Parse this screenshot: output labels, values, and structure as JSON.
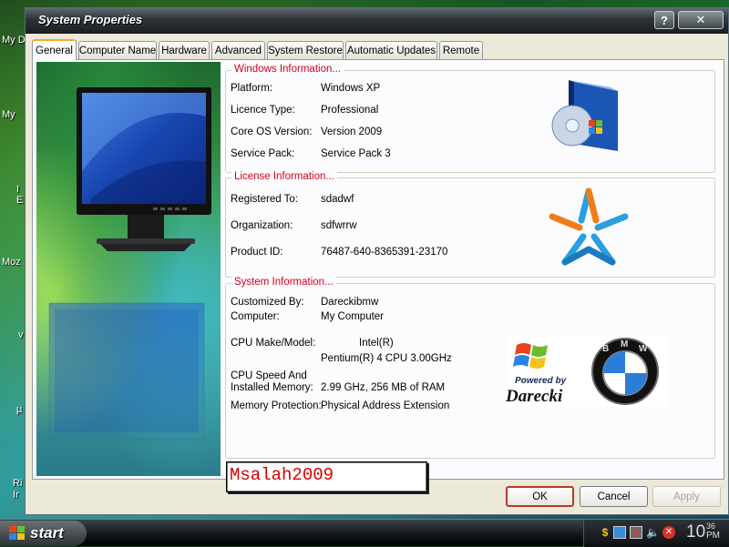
{
  "desktop": {
    "labels": [
      "My D",
      "My",
      "I",
      "E",
      "Moz",
      "v",
      "µ",
      "Ri",
      "Ir"
    ]
  },
  "window": {
    "title": "System Properties",
    "help_label": "?",
    "close_label": "✕"
  },
  "tabs": [
    {
      "label": "General",
      "active": true
    },
    {
      "label": "Computer Name"
    },
    {
      "label": "Hardware"
    },
    {
      "label": "Advanced"
    },
    {
      "label": "System Restore"
    },
    {
      "label": "Automatic Updates"
    },
    {
      "label": "Remote"
    }
  ],
  "windows_info": {
    "title": "Windows Information...",
    "rows": [
      {
        "label": "Platform:",
        "value": "Windows XP"
      },
      {
        "label": "Licence Type:",
        "value": "Professional"
      },
      {
        "label": "Core OS Version:",
        "value": "Version 2009"
      },
      {
        "label": "Service Pack:",
        "value": "Service Pack 3"
      }
    ]
  },
  "license_info": {
    "title": "License Information...",
    "rows": [
      {
        "label": "Registered To:",
        "value": "sdadwf"
      },
      {
        "label": "Organization:",
        "value": "sdfwrrw"
      },
      {
        "label": "Product ID:",
        "value": "76487-640-8365391-23170"
      }
    ]
  },
  "system_info": {
    "title": "System Information...",
    "customized_by_label": "Customized By:",
    "customized_by_value": "Dareckibmw",
    "computer_label": "Computer:",
    "computer_value": "My Computer",
    "cpu_make_label": "CPU Make/Model:",
    "cpu_make_value_1": "Intel(R)",
    "cpu_make_value_2": "Pentium(R) 4 CPU 3.00GHz",
    "cpu_speed_label_1": "CPU Speed And",
    "cpu_speed_label_2": "Installed Memory:",
    "cpu_speed_value": "2.99 GHz, 256 MB of RAM",
    "memory_protection_label": "Memory Protection:",
    "memory_protection_value": "Physical Address Extension"
  },
  "logo": {
    "powered_by": "Powered by",
    "author": "Darecki",
    "brand_letters": [
      "B",
      "M",
      "W"
    ]
  },
  "watermark": "Msalah2009",
  "buttons": {
    "ok": "OK",
    "cancel": "Cancel",
    "apply": "Apply"
  },
  "taskbar": {
    "start_label": "start",
    "clock_hour": "10",
    "clock_minute": "36",
    "clock_ampm": "PM"
  },
  "colors": {
    "group_title": "#d4001a",
    "ok_border": "#b23b2a",
    "watermark": "#d80000"
  }
}
